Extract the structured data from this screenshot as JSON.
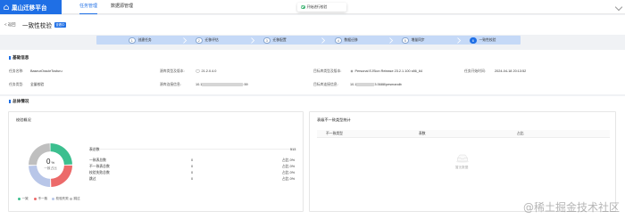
{
  "header": {
    "app_name": "巢山迁移平台",
    "nav_tabs": [
      "任务管理",
      "数据源管理"
    ],
    "toast": "开始进行校验"
  },
  "title_row": {
    "back": "< 返回",
    "title": "一致性校验",
    "badge": "查看中"
  },
  "steps": [
    {
      "num": "1",
      "label": "创建任务"
    },
    {
      "num": "2",
      "label": "迁移评估"
    },
    {
      "num": "3",
      "label": "迁移配置"
    },
    {
      "num": "4",
      "label": "数据迁移"
    },
    {
      "num": "5",
      "label": "增量同步"
    },
    {
      "num": "6",
      "label": "一致性校验"
    }
  ],
  "basic_info": {
    "section_title": "基础信息",
    "task_name_label": "任务名称:",
    "task_name": "BaseurOracleTosfuru",
    "source_type_label": "源库类型及版本:",
    "source_type": "21.2.0.4.0",
    "target_type_label": "目标库类型及版本:",
    "target_type": "Personal EJSion Release 23.2.1.100 x86_64",
    "start_time_label": "任务开始时间:",
    "start_time": "2024-04-18 20:13:52",
    "task_type_label": "任务类型:",
    "task_type": "全量校验",
    "source_conn_label": "源库连接信息:",
    "source_conn_prefix": "10.1",
    "source_conn_suffix": ":59",
    "target_conn_label": "目标库连接信息:",
    "target_conn_prefix": "10.1",
    "target_conn_suffix": "3:3688/pesmandb"
  },
  "overall": {
    "section_title": "总体情况",
    "overview_title": "校验概况",
    "donut_value": "0",
    "donut_unit": "%",
    "donut_caption": "一致占比",
    "rows": [
      {
        "label": "表总数",
        "count": "",
        "pct": "513"
      },
      {
        "label": "一致表总数",
        "count": "0",
        "pct": "占比 0%"
      },
      {
        "label": "不一致表总数",
        "count": "0",
        "pct": "占比 0%"
      },
      {
        "label": "校验失败总数",
        "count": "0",
        "pct": "占比 0%"
      },
      {
        "label": "跳过",
        "count": "0",
        "pct": "占比 0%"
      }
    ],
    "legend": [
      {
        "label": "一致",
        "color": "#3cbf8f"
      },
      {
        "label": "不一致",
        "color": "#ec6a6a"
      },
      {
        "label": "校验失败",
        "color": "#b8c6e8"
      },
      {
        "label": "跳过",
        "color": "#bfbfbf"
      }
    ]
  },
  "mismatch": {
    "title": "表级不一致类型统计",
    "columns": [
      "不一致类型",
      "表数",
      "占比"
    ],
    "empty_text": "暂无数据"
  },
  "watermark": "@稀土掘金技术社区"
}
